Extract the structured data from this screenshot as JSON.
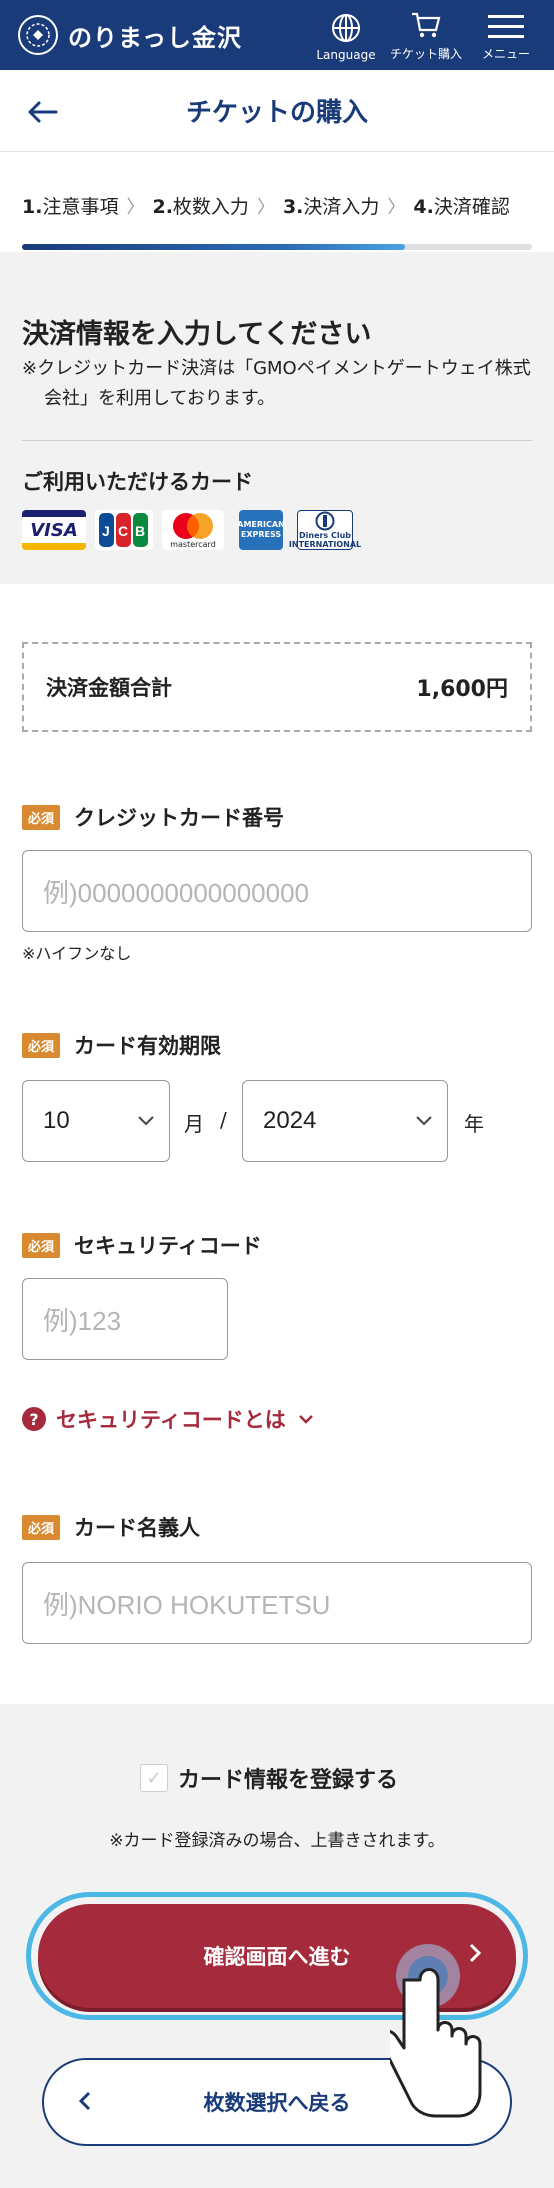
{
  "header": {
    "brand_name": "のりまっし金沢",
    "brand_mark": "",
    "nav": [
      {
        "label": "Language",
        "icon": "globe-icon"
      },
      {
        "label": "チケット購入",
        "icon": "cart-icon"
      },
      {
        "label": "メニュー",
        "icon": "hamburger-icon"
      }
    ]
  },
  "title_bar": {
    "title": "チケットの購入"
  },
  "steps": {
    "items": [
      {
        "num": "1.",
        "label": "注意事項"
      },
      {
        "num": "2.",
        "label": "枚数入力"
      },
      {
        "num": "3.",
        "label": "決済入力"
      },
      {
        "num": "4.",
        "label": "決済確認"
      }
    ],
    "progress_fraction": 0.75
  },
  "info": {
    "heading": "決済情報を入力してください",
    "note": "※クレジットカード決済は「GMOペイメントゲートウェイ株式会社」を利用しております。",
    "cards_heading": "ご利用いただけるカード",
    "cards": [
      "VISA",
      "JCB",
      "mastercard",
      "AMERICAN EXPRESS",
      "Diners Club INTERNATIONAL"
    ]
  },
  "total": {
    "label": "決済金額合計",
    "value": "1,600円"
  },
  "form": {
    "required_badge": "必須",
    "card_number": {
      "label": "クレジットカード番号",
      "placeholder": "例)0000000000000000",
      "hint": "※ハイフンなし"
    },
    "expiry": {
      "label": "カード有効期限",
      "month": "10",
      "month_unit": "月",
      "separator": "/",
      "year": "2024",
      "year_unit": "年"
    },
    "security": {
      "label": "セキュリティコード",
      "placeholder": "例)123",
      "help_link": "セキュリティコードとは"
    },
    "holder": {
      "label": "カード名義人",
      "placeholder": "例)NORIO HOKUTETSU"
    }
  },
  "bottom": {
    "register_label": "カード情報を登録する",
    "register_note": "※カード登録済みの場合、上書きされます。",
    "primary_button": "確認画面へ進む",
    "secondary_button": "枚数選択へ戻る"
  },
  "colors": {
    "navy": "#1a3b79",
    "crimson": "#a52a3c",
    "orange": "#d98a30",
    "highlight": "#4bb8e6"
  }
}
